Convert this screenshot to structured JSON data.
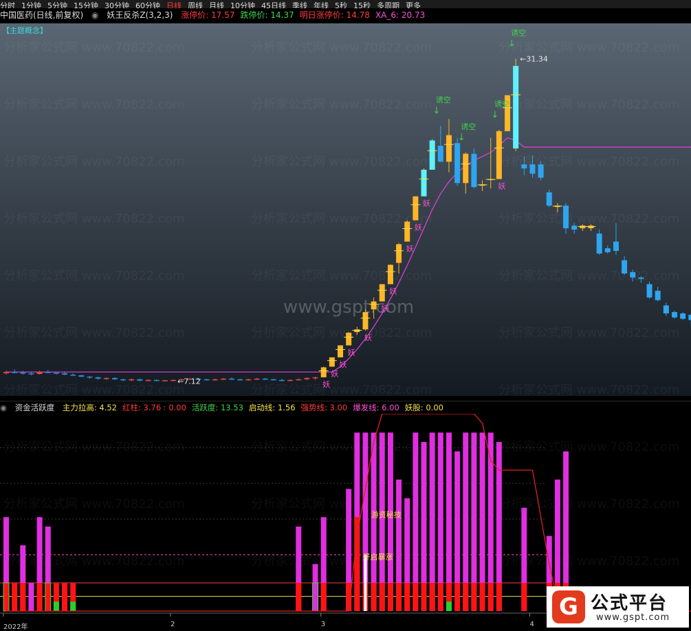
{
  "period_tabs": [
    "分时",
    "1分钟",
    "5分钟",
    "15分钟",
    "30分钟",
    "60分钟",
    "日线",
    "周线",
    "月线",
    "10分钟",
    "45日线",
    "季线",
    "年线",
    "5秒",
    "15秒",
    "多周期",
    "更多"
  ],
  "active_period": "日线",
  "header": {
    "stock": "中国医药(日线,前复权)",
    "indicator": "妖王反杀Z(3,2,3)",
    "items": [
      {
        "label": "涨停价: ",
        "value": "17.57",
        "color": "#ff3b3b"
      },
      {
        "label": "跌停价: ",
        "value": "14.37",
        "color": "#3fd34a"
      },
      {
        "label": "明日涨停价: ",
        "value": "14.78",
        "color": "#ff3b3b"
      },
      {
        "label": "XA_6: ",
        "value": "20.73",
        "color": "#ff4fd8"
      }
    ]
  },
  "theme_tag": "【主题概念】",
  "indicator_header": {
    "name": "资金活跃度",
    "items": [
      {
        "label": "主力拉高: ",
        "value": "4.52",
        "color": "#f2e24a"
      },
      {
        "label": "红柱: ",
        "value": "3.76 : 0.00",
        "color": "#ff3b3b"
      },
      {
        "label": "活跃度: ",
        "value": "13.53",
        "color": "#3fd34a"
      },
      {
        "label": "启动线: ",
        "value": "1.56",
        "color": "#f2e24a"
      },
      {
        "label": "强势线: ",
        "value": "3.00",
        "color": "#ff3b3b"
      },
      {
        "label": "爆发线: ",
        "value": "6.00",
        "color": "#ff4fd8"
      },
      {
        "label": "妖股: ",
        "value": "0.00",
        "color": "#f2e24a"
      }
    ]
  },
  "watermarks": {
    "center": "www.gspt.com",
    "tile": "分析家公式网 www.70822.com"
  },
  "badge": {
    "logo": "G",
    "title": "公式平台",
    "url": "www.gspt.com"
  },
  "date_labels": [
    {
      "text": "2022年",
      "index": 0
    },
    {
      "text": "2",
      "index": 20
    },
    {
      "text": "3",
      "index": 38
    },
    {
      "text": "4",
      "index": 63
    }
  ],
  "chart_data": {
    "type": "candlestick",
    "price_range": [
      6.0,
      34.0
    ],
    "annotations": [
      {
        "text": "←7.12",
        "index": 20,
        "value": 7.12
      },
      {
        "text": "←31.34",
        "index": 61,
        "value": 31.34
      }
    ],
    "candles": [
      {
        "o": 7.7,
        "h": 7.9,
        "l": 7.6,
        "c": 7.8
      },
      {
        "o": 7.8,
        "h": 8.0,
        "l": 7.7,
        "c": 7.75
      },
      {
        "o": 7.75,
        "h": 7.9,
        "l": 7.6,
        "c": 7.7
      },
      {
        "o": 7.7,
        "h": 7.8,
        "l": 7.55,
        "c": 7.65
      },
      {
        "o": 7.65,
        "h": 7.9,
        "l": 7.6,
        "c": 7.8
      },
      {
        "o": 7.8,
        "h": 7.95,
        "l": 7.7,
        "c": 7.75
      },
      {
        "o": 7.75,
        "h": 7.8,
        "l": 7.6,
        "c": 7.7
      },
      {
        "o": 7.7,
        "h": 7.8,
        "l": 7.55,
        "c": 7.6
      },
      {
        "o": 7.6,
        "h": 7.7,
        "l": 7.5,
        "c": 7.55
      },
      {
        "o": 7.55,
        "h": 7.6,
        "l": 7.4,
        "c": 7.45
      },
      {
        "o": 7.45,
        "h": 7.5,
        "l": 7.3,
        "c": 7.4
      },
      {
        "o": 7.4,
        "h": 7.45,
        "l": 7.2,
        "c": 7.3
      },
      {
        "o": 7.3,
        "h": 7.4,
        "l": 7.2,
        "c": 7.35
      },
      {
        "o": 7.35,
        "h": 7.4,
        "l": 7.2,
        "c": 7.25
      },
      {
        "o": 7.25,
        "h": 7.3,
        "l": 7.1,
        "c": 7.2
      },
      {
        "o": 7.2,
        "h": 7.3,
        "l": 7.1,
        "c": 7.25
      },
      {
        "o": 7.25,
        "h": 7.3,
        "l": 7.1,
        "c": 7.15
      },
      {
        "o": 7.15,
        "h": 7.25,
        "l": 7.1,
        "c": 7.2
      },
      {
        "o": 7.2,
        "h": 7.25,
        "l": 7.12,
        "c": 7.15
      },
      {
        "o": 7.15,
        "h": 7.2,
        "l": 7.12,
        "c": 7.18
      },
      {
        "o": 7.18,
        "h": 7.25,
        "l": 7.12,
        "c": 7.2
      },
      {
        "o": 7.2,
        "h": 7.3,
        "l": 7.15,
        "c": 7.25
      },
      {
        "o": 7.25,
        "h": 7.35,
        "l": 7.2,
        "c": 7.3
      },
      {
        "o": 7.3,
        "h": 7.35,
        "l": 7.2,
        "c": 7.25
      },
      {
        "o": 7.25,
        "h": 7.3,
        "l": 7.15,
        "c": 7.2
      },
      {
        "o": 7.2,
        "h": 7.3,
        "l": 7.15,
        "c": 7.25
      },
      {
        "o": 7.25,
        "h": 7.35,
        "l": 7.2,
        "c": 7.3
      },
      {
        "o": 7.3,
        "h": 7.4,
        "l": 7.2,
        "c": 7.25
      },
      {
        "o": 7.25,
        "h": 7.3,
        "l": 7.15,
        "c": 7.2
      },
      {
        "o": 7.2,
        "h": 7.3,
        "l": 7.15,
        "c": 7.25
      },
      {
        "o": 7.25,
        "h": 7.35,
        "l": 7.2,
        "c": 7.3
      },
      {
        "o": 7.3,
        "h": 7.35,
        "l": 7.2,
        "c": 7.25
      },
      {
        "o": 7.25,
        "h": 7.3,
        "l": 7.15,
        "c": 7.2
      },
      {
        "o": 7.2,
        "h": 7.3,
        "l": 7.1,
        "c": 7.15
      },
      {
        "o": 7.15,
        "h": 7.25,
        "l": 7.1,
        "c": 7.2
      },
      {
        "o": 7.2,
        "h": 7.3,
        "l": 7.15,
        "c": 7.25
      },
      {
        "o": 7.25,
        "h": 7.4,
        "l": 7.2,
        "c": 7.35
      },
      {
        "o": 7.35,
        "h": 7.45,
        "l": 7.2,
        "c": 7.4
      },
      {
        "o": 7.4,
        "h": 8.2,
        "l": 7.4,
        "c": 8.15
      },
      {
        "o": 8.2,
        "h": 8.9,
        "l": 8.2,
        "c": 8.9
      },
      {
        "o": 8.9,
        "h": 9.8,
        "l": 8.9,
        "c": 9.8
      },
      {
        "o": 9.8,
        "h": 10.8,
        "l": 9.8,
        "c": 10.75
      },
      {
        "o": 10.8,
        "h": 11.2,
        "l": 10.6,
        "c": 11.0
      },
      {
        "o": 11.0,
        "h": 12.5,
        "l": 10.9,
        "c": 12.3
      },
      {
        "o": 12.5,
        "h": 13.4,
        "l": 11.8,
        "c": 13.1
      },
      {
        "o": 13.1,
        "h": 14.4,
        "l": 13.1,
        "c": 14.4
      },
      {
        "o": 14.4,
        "h": 15.9,
        "l": 14.4,
        "c": 15.85
      },
      {
        "o": 16.0,
        "h": 17.5,
        "l": 15.2,
        "c": 17.4
      },
      {
        "o": 17.6,
        "h": 19.2,
        "l": 17.6,
        "c": 19.1
      },
      {
        "o": 19.2,
        "h": 21.0,
        "l": 19.2,
        "c": 21.0
      },
      {
        "o": 21.0,
        "h": 23.1,
        "l": 21.0,
        "c": 23.0
      },
      {
        "o": 23.0,
        "h": 25.3,
        "l": 23.0,
        "c": 25.2
      },
      {
        "o": 24.8,
        "h": 26.3,
        "l": 23.6,
        "c": 23.6
      },
      {
        "o": 23.6,
        "h": 26.8,
        "l": 22.8,
        "c": 25.6
      },
      {
        "o": 25.0,
        "h": 25.4,
        "l": 21.8,
        "c": 22.0
      },
      {
        "o": 22.0,
        "h": 24.3,
        "l": 21.2,
        "c": 24.2
      },
      {
        "o": 24.2,
        "h": 24.6,
        "l": 21.6,
        "c": 21.7
      },
      {
        "o": 21.8,
        "h": 22.2,
        "l": 21.4,
        "c": 21.9
      },
      {
        "o": 22.3,
        "h": 25.4,
        "l": 21.6,
        "c": 22.3
      },
      {
        "o": 22.3,
        "h": 26.0,
        "l": 22.3,
        "c": 25.9
      },
      {
        "o": 25.9,
        "h": 28.6,
        "l": 25.9,
        "c": 28.6
      },
      {
        "o": 24.6,
        "h": 31.34,
        "l": 24.4,
        "c": 30.8
      },
      {
        "o": 23.4,
        "h": 24.0,
        "l": 22.6,
        "c": 23.1
      },
      {
        "o": 23.4,
        "h": 24.1,
        "l": 22.4,
        "c": 22.7
      },
      {
        "o": 23.4,
        "h": 23.6,
        "l": 22.2,
        "c": 22.4
      },
      {
        "o": 21.3,
        "h": 21.5,
        "l": 20.2,
        "c": 20.3
      },
      {
        "o": 20.2,
        "h": 20.5,
        "l": 19.8,
        "c": 20.3
      },
      {
        "o": 20.3,
        "h": 20.5,
        "l": 18.2,
        "c": 18.6
      },
      {
        "o": 18.8,
        "h": 19.0,
        "l": 18.2,
        "c": 18.5
      },
      {
        "o": 18.6,
        "h": 18.9,
        "l": 18.4,
        "c": 18.8
      },
      {
        "o": 18.6,
        "h": 18.9,
        "l": 18.4,
        "c": 18.8
      },
      {
        "o": 18.2,
        "h": 18.5,
        "l": 16.6,
        "c": 16.7
      },
      {
        "o": 17.1,
        "h": 17.3,
        "l": 16.7,
        "c": 16.8
      },
      {
        "o": 17.6,
        "h": 19.0,
        "l": 16.6,
        "c": 16.9
      },
      {
        "o": 16.2,
        "h": 16.5,
        "l": 15.1,
        "c": 15.2
      },
      {
        "o": 15.3,
        "h": 15.5,
        "l": 14.6,
        "c": 14.9
      },
      {
        "o": 14.9,
        "h": 15.0,
        "l": 14.5,
        "c": 14.8
      },
      {
        "o": 14.4,
        "h": 14.6,
        "l": 13.3,
        "c": 13.4
      },
      {
        "o": 13.9,
        "h": 14.2,
        "l": 13.1,
        "c": 13.2
      },
      {
        "o": 12.8,
        "h": 13.0,
        "l": 12.0,
        "c": 12.2
      },
      {
        "o": 12.3,
        "h": 12.4,
        "l": 11.8,
        "c": 11.9
      },
      {
        "o": 12.2,
        "h": 12.3,
        "l": 11.7,
        "c": 11.8
      },
      {
        "o": 12.1,
        "h": 12.2,
        "l": 11.2,
        "c": 11.7
      },
      {
        "o": 11.8,
        "h": 12.4,
        "l": 11.6,
        "c": 12.3
      },
      {
        "o": 11.7,
        "h": 12.6,
        "l": 11.6,
        "c": 12.4
      },
      {
        "o": 12.0,
        "h": 13.2,
        "l": 11.9,
        "c": 12.9
      }
    ],
    "upper_band": [
      7.8,
      7.8,
      7.8,
      7.8,
      7.8,
      7.8,
      7.8,
      7.8,
      7.8,
      7.8,
      7.8,
      7.8,
      7.8,
      7.8,
      7.8,
      7.8,
      7.8,
      7.8,
      7.8,
      7.8,
      7.8,
      7.8,
      7.8,
      7.8,
      7.8,
      7.8,
      7.8,
      7.8,
      7.8,
      7.8,
      7.8,
      7.8,
      7.8,
      7.8,
      7.8,
      7.8,
      7.8,
      7.8,
      7.8,
      7.8,
      8.2,
      8.8,
      9.5,
      10.3,
      11.2,
      12.2,
      13.3,
      14.5,
      15.8,
      17.2,
      18.6,
      20.0,
      21.2,
      22.1,
      22.8,
      23.3,
      23.7,
      24.0,
      24.3,
      24.8,
      25.4,
      25.2,
      24.7,
      24.7,
      24.7,
      24.7,
      24.7,
      24.7,
      24.7,
      24.7,
      24.7,
      24.7,
      24.7,
      24.7,
      24.7,
      24.7,
      24.7,
      24.7,
      24.7,
      24.7,
      24.7,
      24.7,
      24.7
    ],
    "signals": [
      {
        "index": 38,
        "text": "妖"
      },
      {
        "index": 39,
        "text": "妖"
      },
      {
        "index": 40,
        "text": "妖"
      },
      {
        "index": 41,
        "text": "妖"
      },
      {
        "index": 43,
        "text": "妖"
      },
      {
        "index": 45,
        "text": "妖"
      },
      {
        "index": 46,
        "text": "妖"
      },
      {
        "index": 48,
        "text": "妖"
      },
      {
        "index": 49,
        "text": "妖"
      },
      {
        "index": 50,
        "text": "妖"
      },
      {
        "index": 59,
        "text": "妖"
      }
    ],
    "short_traps": [
      {
        "index": 52,
        "text": "诱空"
      },
      {
        "index": 55,
        "text": "诱空"
      },
      {
        "index": 59,
        "text": "诱空"
      },
      {
        "index": 61,
        "text": "诱空"
      }
    ],
    "indicator": {
      "range": [
        0,
        21
      ],
      "levels": [
        {
          "name": "启动线",
          "value": 1.56,
          "color": "#f2e24a"
        },
        {
          "name": "强势线",
          "value": 3.0,
          "color": "#ff3b3b"
        },
        {
          "name": "爆发线",
          "value": 6.0,
          "color": "#ff4fd8",
          "dashed": true
        }
      ],
      "magenta": [
        10,
        0,
        7,
        3,
        10,
        9,
        0,
        3,
        0,
        0,
        0,
        0,
        0,
        0,
        0,
        0,
        0,
        0,
        0,
        0,
        0,
        0,
        0,
        0,
        0,
        0,
        0,
        0,
        0,
        0,
        0,
        0,
        0,
        0,
        0,
        9,
        0,
        5,
        10,
        0,
        0,
        13,
        19,
        19,
        19,
        19,
        19,
        14,
        12,
        19,
        18,
        19,
        19,
        19,
        17,
        19,
        19,
        19,
        19,
        18,
        0,
        0,
        11,
        0,
        0,
        8,
        14,
        17,
        0,
        0,
        0,
        0,
        0,
        0,
        0,
        0,
        0,
        0,
        0,
        0,
        0,
        0,
        0
      ],
      "red": [
        3,
        3,
        3,
        0,
        3,
        3,
        3,
        3,
        3,
        0,
        0,
        0,
        0,
        0,
        0,
        0,
        0,
        0,
        0,
        0,
        0,
        0,
        0,
        0,
        0,
        0,
        0,
        0,
        0,
        0,
        0,
        0,
        0,
        0,
        0,
        3,
        0,
        0,
        3,
        0,
        0,
        3,
        10,
        3,
        3,
        3,
        3,
        3,
        3,
        3,
        3,
        3,
        3,
        3,
        3,
        3,
        3,
        3,
        3,
        3,
        0,
        0,
        3,
        0,
        0,
        3,
        3,
        3,
        0,
        0,
        0,
        0,
        0,
        0,
        0,
        0,
        0,
        0,
        0,
        0,
        0,
        0,
        0
      ],
      "green": [
        0,
        0,
        0,
        0,
        0,
        0,
        1,
        0,
        1,
        0,
        0,
        0,
        0,
        0,
        0,
        0,
        0,
        0,
        0,
        0,
        0,
        0,
        0,
        0,
        0,
        0,
        0,
        0,
        0,
        0,
        0,
        0,
        0,
        0,
        0,
        0,
        0,
        0,
        0,
        0,
        0,
        0,
        0,
        0,
        0,
        0,
        0,
        0,
        0,
        0,
        0,
        0,
        0,
        1,
        0,
        0,
        0,
        0,
        0,
        0,
        0,
        0,
        0,
        0,
        0,
        0,
        0,
        0,
        0,
        0,
        1,
        0,
        0,
        0,
        0,
        0,
        0,
        0,
        0,
        0,
        0,
        0,
        0
      ],
      "hollow": [
        3,
        0,
        0,
        0,
        0,
        3,
        0,
        0,
        0,
        0,
        0,
        0,
        0,
        0,
        0,
        0,
        0,
        0,
        0,
        0,
        0,
        0,
        0,
        0,
        0,
        0,
        0,
        0,
        0,
        0,
        0,
        0,
        0,
        0,
        0,
        0,
        0,
        3,
        0,
        0,
        0,
        0,
        0,
        0,
        0,
        0,
        0,
        0,
        0,
        0,
        0,
        0,
        0,
        0,
        0,
        0,
        0,
        0,
        0,
        0,
        0,
        0,
        0,
        0,
        0,
        0,
        0,
        0,
        0,
        0,
        0,
        0,
        0,
        0,
        0,
        0,
        0,
        0,
        0,
        0,
        0,
        0,
        0
      ],
      "white_index": 43,
      "red_line": [
        0,
        0,
        0,
        0,
        0,
        0,
        0,
        0,
        0,
        0,
        0,
        0,
        0,
        0,
        0,
        0,
        0,
        0,
        0,
        0,
        0,
        0,
        0,
        0,
        0,
        0,
        0,
        0,
        0,
        0,
        0,
        0,
        0,
        0,
        0,
        0,
        0,
        0,
        0,
        0,
        0,
        0,
        8,
        13,
        18,
        21,
        21,
        21,
        21,
        21,
        21,
        21,
        21,
        21,
        21,
        21,
        21,
        20,
        16,
        15,
        15,
        15,
        15,
        15,
        10,
        5,
        1,
        0,
        0,
        0,
        0,
        0,
        0,
        0,
        0,
        0,
        0,
        0,
        0,
        0,
        0,
        0,
        0
      ],
      "labels": [
        {
          "index": 44,
          "value": 10,
          "text": "游资秘技",
          "color": "#f2e24a"
        },
        {
          "index": 43,
          "value": 5.5,
          "text": "开启暴涨",
          "color": "#f2e24a"
        }
      ]
    }
  }
}
